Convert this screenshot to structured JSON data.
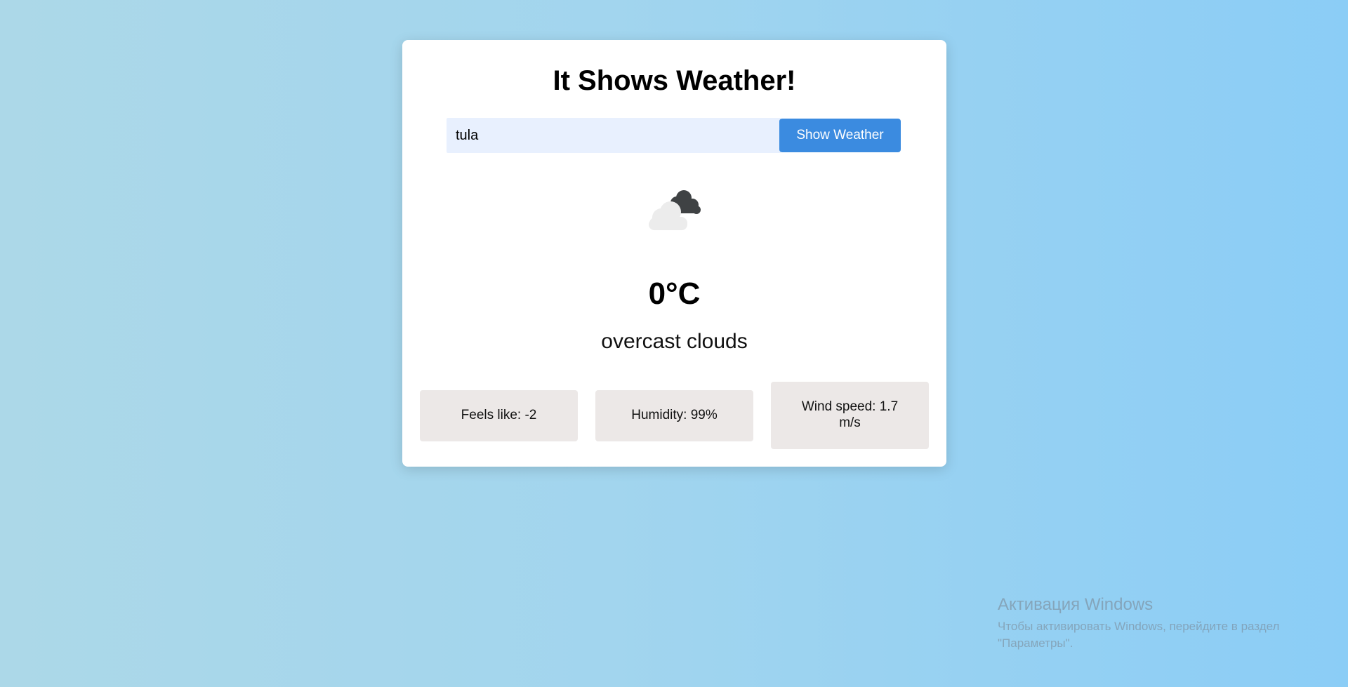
{
  "app": {
    "title": "It Shows Weather!"
  },
  "search": {
    "value": "tula",
    "button_label": "Show Weather"
  },
  "weather": {
    "icon": "overcast-clouds-icon",
    "temperature": "0°C",
    "description": "overcast clouds"
  },
  "stats": {
    "feels_like": "Feels like: -2",
    "humidity": "Humidity: 99%",
    "wind_speed": "Wind speed: 1.7 m/s"
  },
  "os_watermark": {
    "title": "Активация Windows",
    "text": "Чтобы активировать Windows, перейдите в раздел \"Параметры\"."
  },
  "colors": {
    "accent": "#3b8be0",
    "input_bg": "#e8f0fe",
    "stat_bg": "#ece8e7",
    "card_bg": "#ffffff"
  }
}
